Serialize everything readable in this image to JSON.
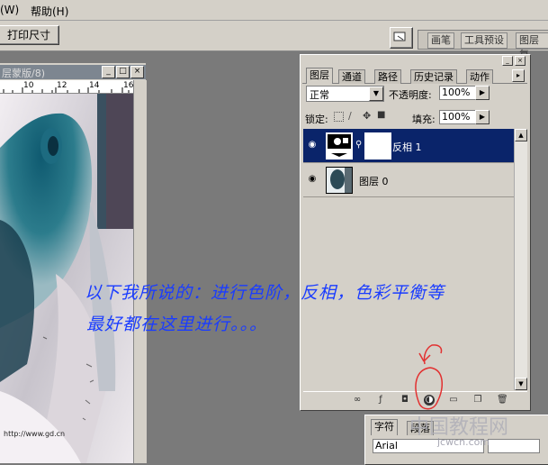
{
  "menu": {
    "items": [
      "(W)",
      "帮助(H)"
    ]
  },
  "options_bar": {
    "print_size_label": "打印尺寸"
  },
  "palette_well": {
    "tabs": [
      "画笔",
      "工具预设",
      "图层复"
    ]
  },
  "document": {
    "title": "层蒙版/8)",
    "ruler_marks": [
      "10",
      "12",
      "14",
      "16"
    ],
    "canvas_text": "http://www.gd.cn"
  },
  "layers_panel": {
    "tabs": [
      "图层",
      "通道",
      "路径",
      "历史记录",
      "动作"
    ],
    "blend_mode": "正常",
    "opacity_label": "不透明度:",
    "opacity_value": "100%",
    "lock_label": "锁定:",
    "fill_label": "填充:",
    "fill_value": "100%",
    "layers": [
      {
        "name": "反相 1",
        "selected": true
      },
      {
        "name": "图层 0",
        "selected": false
      }
    ]
  },
  "character_panel": {
    "tabs": [
      "字符",
      "段落"
    ],
    "font": "Arial"
  },
  "annotation": {
    "line1": "以下我所说的：进行色阶，反相，色彩平衡等",
    "line2": "最好都在这里进行。。。"
  },
  "watermark": {
    "site_name": "中国教程网",
    "url": "jcwcn.com"
  },
  "colors": {
    "selection": "#0a246a",
    "annotation": "#1a3cff",
    "panel": "#d4d0c8"
  }
}
